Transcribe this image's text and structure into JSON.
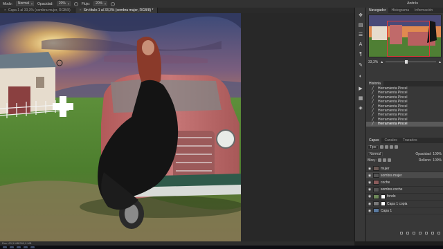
{
  "optbar": {
    "mode_label": "Modo:",
    "mode_value": "Normal",
    "opacity_label": "Opacidad:",
    "opacity_value": "20%",
    "flow_label": "Flujo:",
    "flow_value": "20%",
    "user": "Andrés"
  },
  "tabs": [
    {
      "label": "Capa 1 al 33,3% (sombra mujer, RGB/8)",
      "active": false
    },
    {
      "label": "Sin título-1 al 33,3% (sombra mujer, RGB/8) *",
      "active": true
    }
  ],
  "navigator": {
    "tabs": [
      "Navegador",
      "Histograma",
      "Información"
    ],
    "zoom": "33,3%"
  },
  "history": {
    "title": "Historia",
    "items": [
      {
        "label": "Herramienta Pincel",
        "active": false
      },
      {
        "label": "Herramienta Pincel",
        "active": false
      },
      {
        "label": "Herramienta Pincel",
        "active": false
      },
      {
        "label": "Herramienta Pincel",
        "active": false
      },
      {
        "label": "Herramienta Pincel",
        "active": false
      },
      {
        "label": "Herramienta Pincel",
        "active": false
      },
      {
        "label": "Herramienta Pincel",
        "active": false
      },
      {
        "label": "Herramienta Pincel",
        "active": false
      },
      {
        "label": "Herramienta Pincel",
        "active": true
      }
    ]
  },
  "layers_panel": {
    "tabs": [
      "Capas",
      "Canales",
      "Trazados"
    ],
    "filter": "Tipo",
    "blend_mode": "Normal",
    "opacity_label": "Opacidad:",
    "opacity_value": "100%",
    "lock_label": "Bloq.:",
    "fill_label": "Relleno:",
    "fill_value": "100%",
    "layers": [
      {
        "name": "mujer",
        "selected": false,
        "mask": false,
        "thumb": "#6b5a55"
      },
      {
        "name": "sombra mujer",
        "selected": true,
        "mask": false,
        "thumb": "#555"
      },
      {
        "name": "coche",
        "selected": false,
        "mask": false,
        "thumb": "#8a5b5b"
      },
      {
        "name": "sombra coche",
        "selected": false,
        "mask": false,
        "thumb": "#555"
      },
      {
        "name": "fondo",
        "selected": false,
        "mask": true,
        "thumb": "#6f8a5a"
      },
      {
        "name": "Capa 1 copia",
        "selected": false,
        "mask": true,
        "thumb": "#7a7a7a"
      },
      {
        "name": "Capa 1",
        "selected": false,
        "mask": false,
        "thumb": "#5a7aa0"
      }
    ]
  },
  "status": {
    "doc": "Doc: 63,3 MB/260,9 MB"
  }
}
